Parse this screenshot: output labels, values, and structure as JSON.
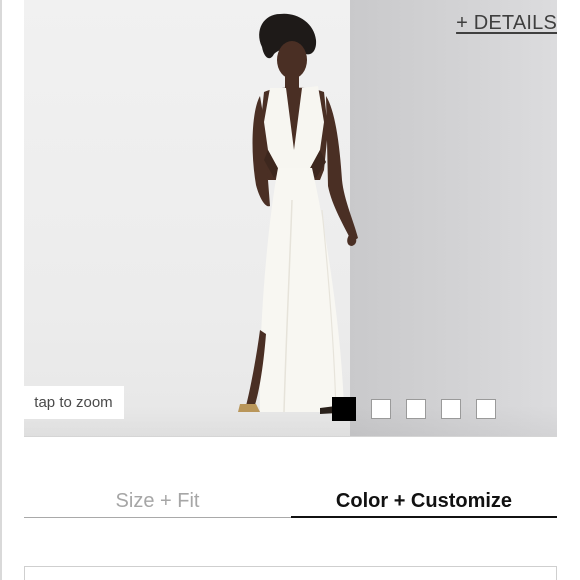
{
  "product": {
    "details_link": "+ DETAILS",
    "zoom_label": "tap to zoom",
    "swatches": [
      {
        "color": "#000000",
        "selected": true
      },
      {
        "color": "#ffffff",
        "selected": false
      },
      {
        "color": "#ffffff",
        "selected": false
      },
      {
        "color": "#ffffff",
        "selected": false
      },
      {
        "color": "#ffffff",
        "selected": false
      }
    ]
  },
  "tabs": [
    {
      "label": "Size + Fit",
      "active": false
    },
    {
      "label": "Color + Customize",
      "active": true
    }
  ]
}
